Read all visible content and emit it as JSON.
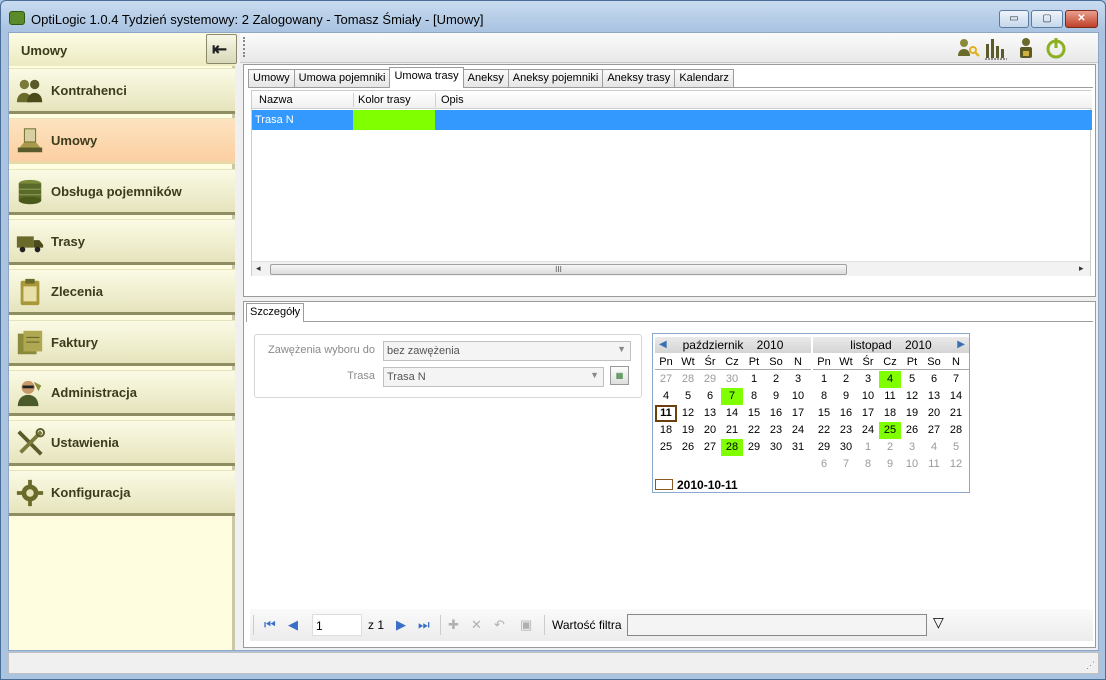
{
  "window": {
    "title": "OptiLogic 1.0.4  Tydzień systemowy: 2  Zalogowany - Tomasz Śmiały - [Umowy]",
    "minimize_label": "▭",
    "maximize_label": "▢",
    "close_label": "✕"
  },
  "sidebar": {
    "header": "Umowy",
    "collapse_icon": "arrow-left-bar-icon",
    "items": [
      {
        "label": "Kontrahenci",
        "icon": "people-icon"
      },
      {
        "label": "Umowy",
        "icon": "contract-icon",
        "active": true
      },
      {
        "label": "Obsługa pojemników",
        "icon": "container-stack-icon"
      },
      {
        "label": "Trasy",
        "icon": "truck-icon"
      },
      {
        "label": "Zlecenia",
        "icon": "clipboard-icon"
      },
      {
        "label": "Faktury",
        "icon": "invoice-icon"
      },
      {
        "label": "Administracja",
        "icon": "admin-person-icon"
      },
      {
        "label": "Ustawienia",
        "icon": "tools-icon"
      },
      {
        "label": "Konfiguracja",
        "icon": "gear-icon"
      }
    ]
  },
  "toolbar": {
    "icons": [
      "user-key-icon",
      "bar-chart-icon",
      "user-lock-icon",
      "power-icon"
    ]
  },
  "tabs": [
    "Umowy",
    "Umowa pojemniki",
    "Umowa trasy",
    "Aneksy",
    "Aneksy pojemniki",
    "Aneksy trasy",
    "Kalendarz"
  ],
  "active_tab": "Umowa trasy",
  "grid": {
    "columns": [
      "Nazwa",
      "Kolor trasy",
      "Opis"
    ],
    "rows": [
      {
        "nazwa": "Trasa N",
        "kolor": "#7fff00",
        "opis": ""
      }
    ],
    "scroll_grip": "III"
  },
  "detail": {
    "tab": "Szczegóły",
    "filter1_label": "Zawężenia wyboru do",
    "filter1_value": "bez zawężenia",
    "filter2_label": "Trasa",
    "filter2_value": "Trasa N"
  },
  "calendar": {
    "weekdays": [
      "Pn",
      "Wt",
      "Śr",
      "Cz",
      "Pt",
      "So",
      "N"
    ],
    "months": [
      {
        "name": "październik",
        "year": "2010",
        "days": [
          "27",
          "28",
          "29",
          "30",
          "1",
          "2",
          "3",
          "4",
          "5",
          "6",
          "7",
          "8",
          "9",
          "10",
          "11",
          "12",
          "13",
          "14",
          "15",
          "16",
          "17",
          "18",
          "19",
          "20",
          "21",
          "22",
          "23",
          "24",
          "25",
          "26",
          "27",
          "28",
          "29",
          "30",
          "31"
        ],
        "other_month_idx": [
          0,
          1,
          2,
          3
        ],
        "highlight_idx": [
          10,
          31
        ],
        "today_idx": 14
      },
      {
        "name": "listopad",
        "year": "2010",
        "days": [
          "1",
          "2",
          "3",
          "4",
          "5",
          "6",
          "7",
          "8",
          "9",
          "10",
          "11",
          "12",
          "13",
          "14",
          "15",
          "16",
          "17",
          "18",
          "19",
          "20",
          "21",
          "22",
          "23",
          "24",
          "25",
          "26",
          "27",
          "28",
          "29",
          "30",
          "1",
          "2",
          "3",
          "4",
          "5",
          "6",
          "7",
          "8",
          "9",
          "10",
          "11",
          "12"
        ],
        "other_month_idx": [
          30,
          31,
          32,
          33,
          34,
          35,
          36,
          37,
          38,
          39,
          40,
          41
        ],
        "highlight_idx": [
          3,
          24
        ],
        "today_idx": -1
      }
    ],
    "selected_date": "2010-10-11",
    "highlight_color": "#7fff00"
  },
  "navigator": {
    "page": "1",
    "of_label": "z 1",
    "filter_label": "Wartość filtra",
    "filter_value": ""
  }
}
